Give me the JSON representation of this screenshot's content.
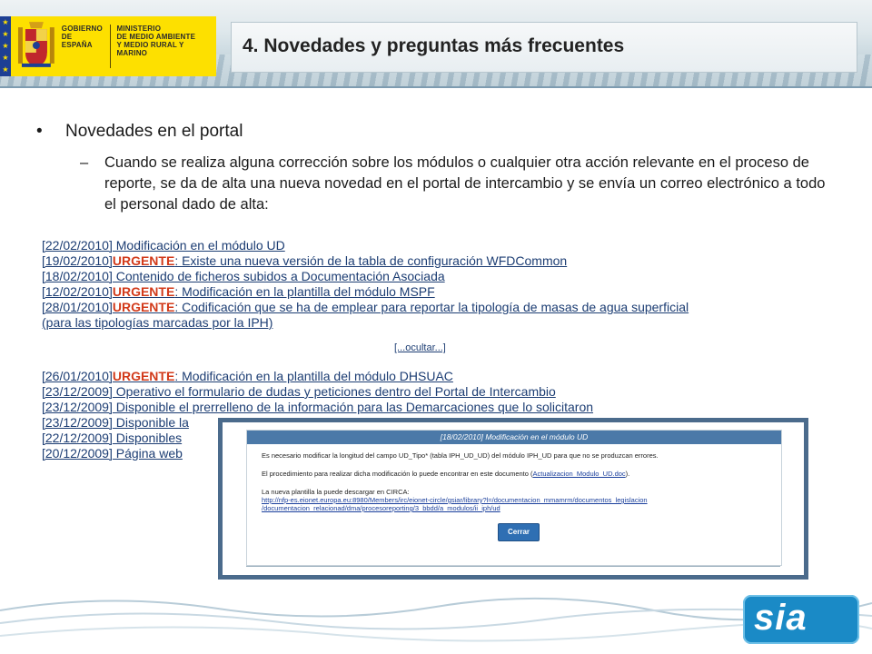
{
  "header": {
    "gobierno_label": "GOBIERNO\nDE ESPAÑA",
    "ministerio_label": "MINISTERIO\nDE MEDIO AMBIENTE\nY MEDIO RURAL Y MARINO",
    "title": "4. Novedades y preguntas más frecuentes"
  },
  "content": {
    "bullet_dot": "•",
    "bullet_text": "Novedades en el portal",
    "sub_dash": "–",
    "sub_text": "Cuando se realiza alguna corrección sobre los módulos o cualquier otra acción relevante en el proceso de reporte, se da de alta una nueva novedad en el portal de intercambio y se envía un correo electrónico a todo el personal dado de alta:"
  },
  "news": [
    {
      "date": "[22/02/2010]",
      "urgent": "",
      "text": " Modificación en el módulo UD"
    },
    {
      "date": "[19/02/2010]",
      "urgent": "URGENTE",
      "text": ": Existe una nueva versión de la tabla de configuración WFDCommon"
    },
    {
      "date": "[18/02/2010]",
      "urgent": "",
      "text": " Contenido de ficheros subidos a Documentación Asociada"
    },
    {
      "date": "[12/02/2010]",
      "urgent": "URGENTE",
      "text": ": Modificación en la plantilla del módulo MSPF"
    },
    {
      "date": "[28/01/2010]",
      "urgent": "URGENTE",
      "text": ": Codificación que se ha de emplear para reportar la tipología de masas de agua superficial"
    },
    {
      "date": "",
      "urgent": "",
      "text": "(para las tipologías marcadas por la IPH)"
    },
    {
      "date": "[26/01/2010]",
      "urgent": "URGENTE",
      "text": ": Modificación en la plantilla del módulo DHSUAC"
    },
    {
      "date": "[23/12/2009]",
      "urgent": "",
      "text": " Operativo el formulario de dudas y peticiones dentro del Portal de Intercambio"
    },
    {
      "date": "[23/12/2009]",
      "urgent": "",
      "text": " Disponible el prerrelleno de la información para las Demarcaciones que lo solicitaron"
    },
    {
      "date": "[23/12/2009]",
      "urgent": "",
      "text": " Disponible la"
    },
    {
      "date": "[22/12/2009]",
      "urgent": "",
      "text": " Disponibles"
    },
    {
      "date": "[20/12/2009]",
      "urgent": "",
      "text": " Página web"
    }
  ],
  "ocultar_label": "[...ocultar...]",
  "popup": {
    "header": "[18/02/2010] Modificación en el módulo UD",
    "line1": "Es necesario modificar la longitud del campo UD_Tipo* (tabla IPH_UD_UD) del módulo IPH_UD para que no se produzcan errores.",
    "line2_pre": "El procedimiento para realizar dicha modificación lo puede encontrar en este documento (",
    "line2_link": "Actualizacion_Modulo_UD.doc",
    "line2_post": ").",
    "line3": "La nueva plantilla la puede descargar en CIRCA:",
    "link_a": "http://nfp-es.eionet.europa.eu:8980/Members/irc/eionet-circle/gsiar/library?l=/documentacion_mmamrm/documentos_legislacion",
    "link_b": "/documentacion_relacionad/dma/procesoreporting/3_bbdd/a_modulos/ii_iph/ud",
    "button": "Cerrar"
  },
  "footer": {
    "logo_text": "sia"
  },
  "colors": {
    "urgent": "#d23a1a",
    "link": "#1c3d73",
    "popup_border": "#4b6b8c",
    "sia_blue": "#1a8ac6"
  }
}
